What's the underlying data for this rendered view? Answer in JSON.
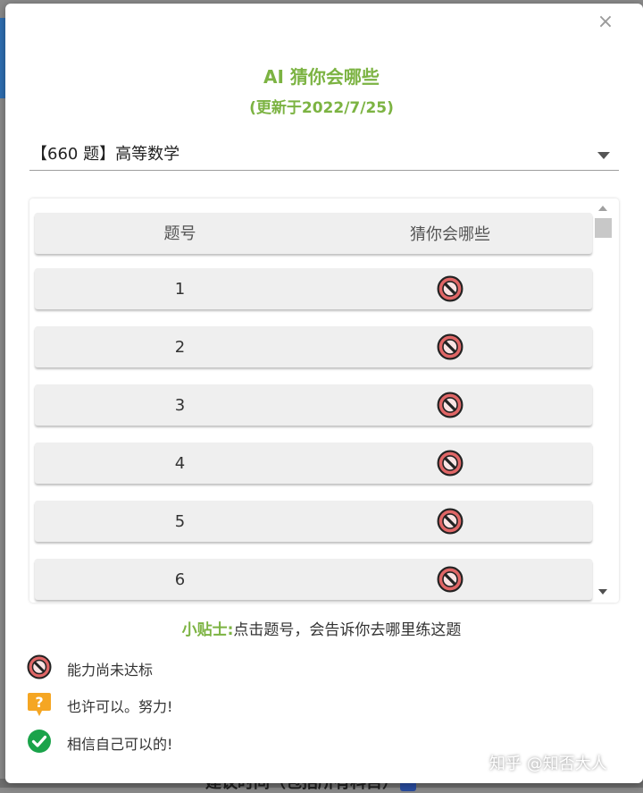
{
  "dialog": {
    "close_glyph": "×",
    "title": "AI 猜你会哪些",
    "subtitle": "(更新于2022/7/25)",
    "select": {
      "value": "【660 题】高等数学"
    }
  },
  "table": {
    "headers": {
      "number": "题号",
      "guess": "猜你会哪些"
    },
    "rows": [
      {
        "number": "1",
        "status_icon": "prohibited-icon"
      },
      {
        "number": "2",
        "status_icon": "prohibited-icon"
      },
      {
        "number": "3",
        "status_icon": "prohibited-icon"
      },
      {
        "number": "4",
        "status_icon": "prohibited-icon"
      },
      {
        "number": "5",
        "status_icon": "prohibited-icon"
      },
      {
        "number": "6",
        "status_icon": "prohibited-icon"
      }
    ]
  },
  "tip": {
    "label": "小贴士:",
    "text": "点击题号，会告诉你去哪里练这题"
  },
  "legend": [
    {
      "icon": "prohibited-icon",
      "text": "能力尚未达标"
    },
    {
      "icon": "question-icon",
      "text": "也许可以。努力!"
    },
    {
      "icon": "check-icon",
      "text": "相信自己可以的!"
    }
  ],
  "background": {
    "partial_text": "建议时间（包括所有科目）"
  },
  "watermark": "知乎 @知否大人",
  "colors": {
    "accent": "#7cb342",
    "prohibited": "#e06666",
    "question": "#f5a623",
    "check": "#1aa34a"
  }
}
